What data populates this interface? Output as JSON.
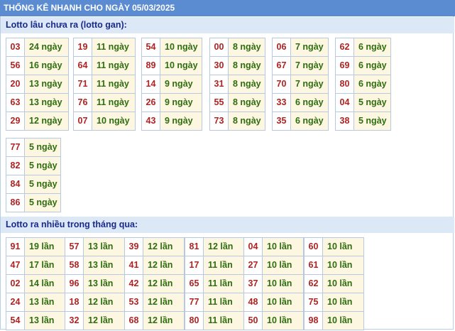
{
  "header": {
    "title": "THỐNG KÊ NHANH CHO NGÀY 05/03/2025"
  },
  "colors": {
    "header_bg": "#5b8bd0",
    "section_bg": "#dce8f6",
    "number_color": "#b02222",
    "value_color": "#2e6e10",
    "value_bg": "#fdf6e0"
  },
  "gan": {
    "title": "Lotto lâu chưa ra (lotto gan):",
    "columns": [
      [
        [
          "03",
          "24 ngày"
        ],
        [
          "56",
          "16 ngày"
        ],
        [
          "20",
          "13 ngày"
        ],
        [
          "63",
          "13 ngày"
        ],
        [
          "29",
          "12 ngày"
        ]
      ],
      [
        [
          "19",
          "11 ngày"
        ],
        [
          "64",
          "11 ngày"
        ],
        [
          "71",
          "11 ngày"
        ],
        [
          "76",
          "11 ngày"
        ],
        [
          "07",
          "10 ngày"
        ]
      ],
      [
        [
          "54",
          "10 ngày"
        ],
        [
          "89",
          "10 ngày"
        ],
        [
          "14",
          "9 ngày"
        ],
        [
          "26",
          "9 ngày"
        ],
        [
          "43",
          "9 ngày"
        ]
      ],
      [
        [
          "00",
          "8 ngày"
        ],
        [
          "30",
          "8 ngày"
        ],
        [
          "31",
          "8 ngày"
        ],
        [
          "55",
          "8 ngày"
        ],
        [
          "73",
          "8 ngày"
        ]
      ],
      [
        [
          "06",
          "7 ngày"
        ],
        [
          "67",
          "7 ngày"
        ],
        [
          "70",
          "7 ngày"
        ],
        [
          "33",
          "6 ngày"
        ],
        [
          "35",
          "6 ngày"
        ]
      ],
      [
        [
          "62",
          "6 ngày"
        ],
        [
          "69",
          "6 ngày"
        ],
        [
          "80",
          "6 ngày"
        ],
        [
          "04",
          "5 ngày"
        ],
        [
          "38",
          "5 ngày"
        ]
      ],
      [
        [
          "77",
          "5 ngày"
        ],
        [
          "82",
          "5 ngày"
        ],
        [
          "84",
          "5 ngày"
        ],
        [
          "86",
          "5 ngày"
        ]
      ]
    ]
  },
  "frequent": {
    "title": "Lotto ra nhiều trong tháng qua:",
    "columns": [
      [
        [
          "91",
          "19 lần"
        ],
        [
          "47",
          "17 lần"
        ],
        [
          "02",
          "14 lần"
        ],
        [
          "24",
          "13 lần"
        ],
        [
          "54",
          "13 lần"
        ]
      ],
      [
        [
          "57",
          "13 lần"
        ],
        [
          "58",
          "13 lần"
        ],
        [
          "96",
          "13 lần"
        ],
        [
          "18",
          "12 lần"
        ],
        [
          "32",
          "12 lần"
        ]
      ],
      [
        [
          "39",
          "12 lần"
        ],
        [
          "41",
          "12 lần"
        ],
        [
          "42",
          "12 lần"
        ],
        [
          "53",
          "12 lần"
        ],
        [
          "68",
          "12 lần"
        ]
      ],
      [
        [
          "81",
          "12 lần"
        ],
        [
          "17",
          "11 lần"
        ],
        [
          "65",
          "11 lần"
        ],
        [
          "77",
          "11 lần"
        ],
        [
          "80",
          "11 lần"
        ]
      ],
      [
        [
          "04",
          "10 lần"
        ],
        [
          "27",
          "10 lần"
        ],
        [
          "37",
          "10 lần"
        ],
        [
          "48",
          "10 lần"
        ],
        [
          "50",
          "10 lần"
        ]
      ],
      [
        [
          "60",
          "10 lần"
        ],
        [
          "61",
          "10 lần"
        ],
        [
          "62",
          "10 lần"
        ],
        [
          "75",
          "10 lần"
        ],
        [
          "98",
          "10 lần"
        ]
      ]
    ]
  }
}
